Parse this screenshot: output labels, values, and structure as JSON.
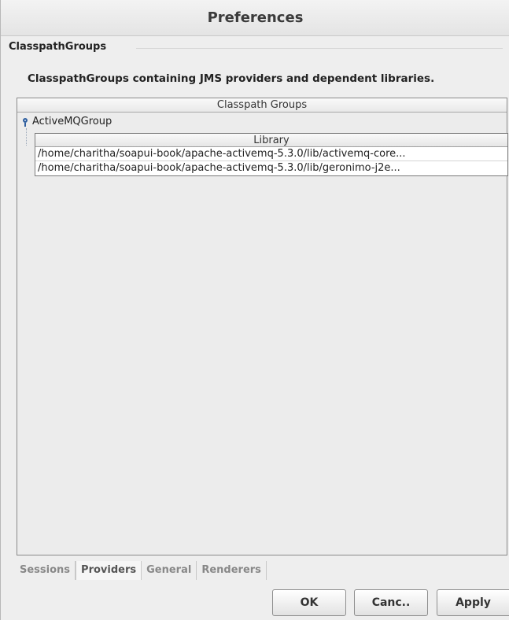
{
  "window": {
    "title": "Preferences"
  },
  "section": {
    "label": "ClasspathGroups",
    "description": "ClasspathGroups containing JMS providers and dependent libraries."
  },
  "tree": {
    "header": "Classpath Groups",
    "node": {
      "label": "ActiveMQGroup",
      "icon": "tree-node-icon"
    },
    "library_table": {
      "header": "Library",
      "rows": [
        "/home/charitha/soapui-book/apache-activemq-5.3.0/lib/activemq-core...",
        "/home/charitha/soapui-book/apache-activemq-5.3.0/lib/geronimo-j2e..."
      ]
    }
  },
  "tabs": [
    {
      "label": "Sessions",
      "active": false
    },
    {
      "label": "Providers",
      "active": true
    },
    {
      "label": "General",
      "active": false
    },
    {
      "label": "Renderers",
      "active": false
    }
  ],
  "buttons": {
    "ok": "OK",
    "cancel": "Canc..",
    "apply": "Apply"
  }
}
